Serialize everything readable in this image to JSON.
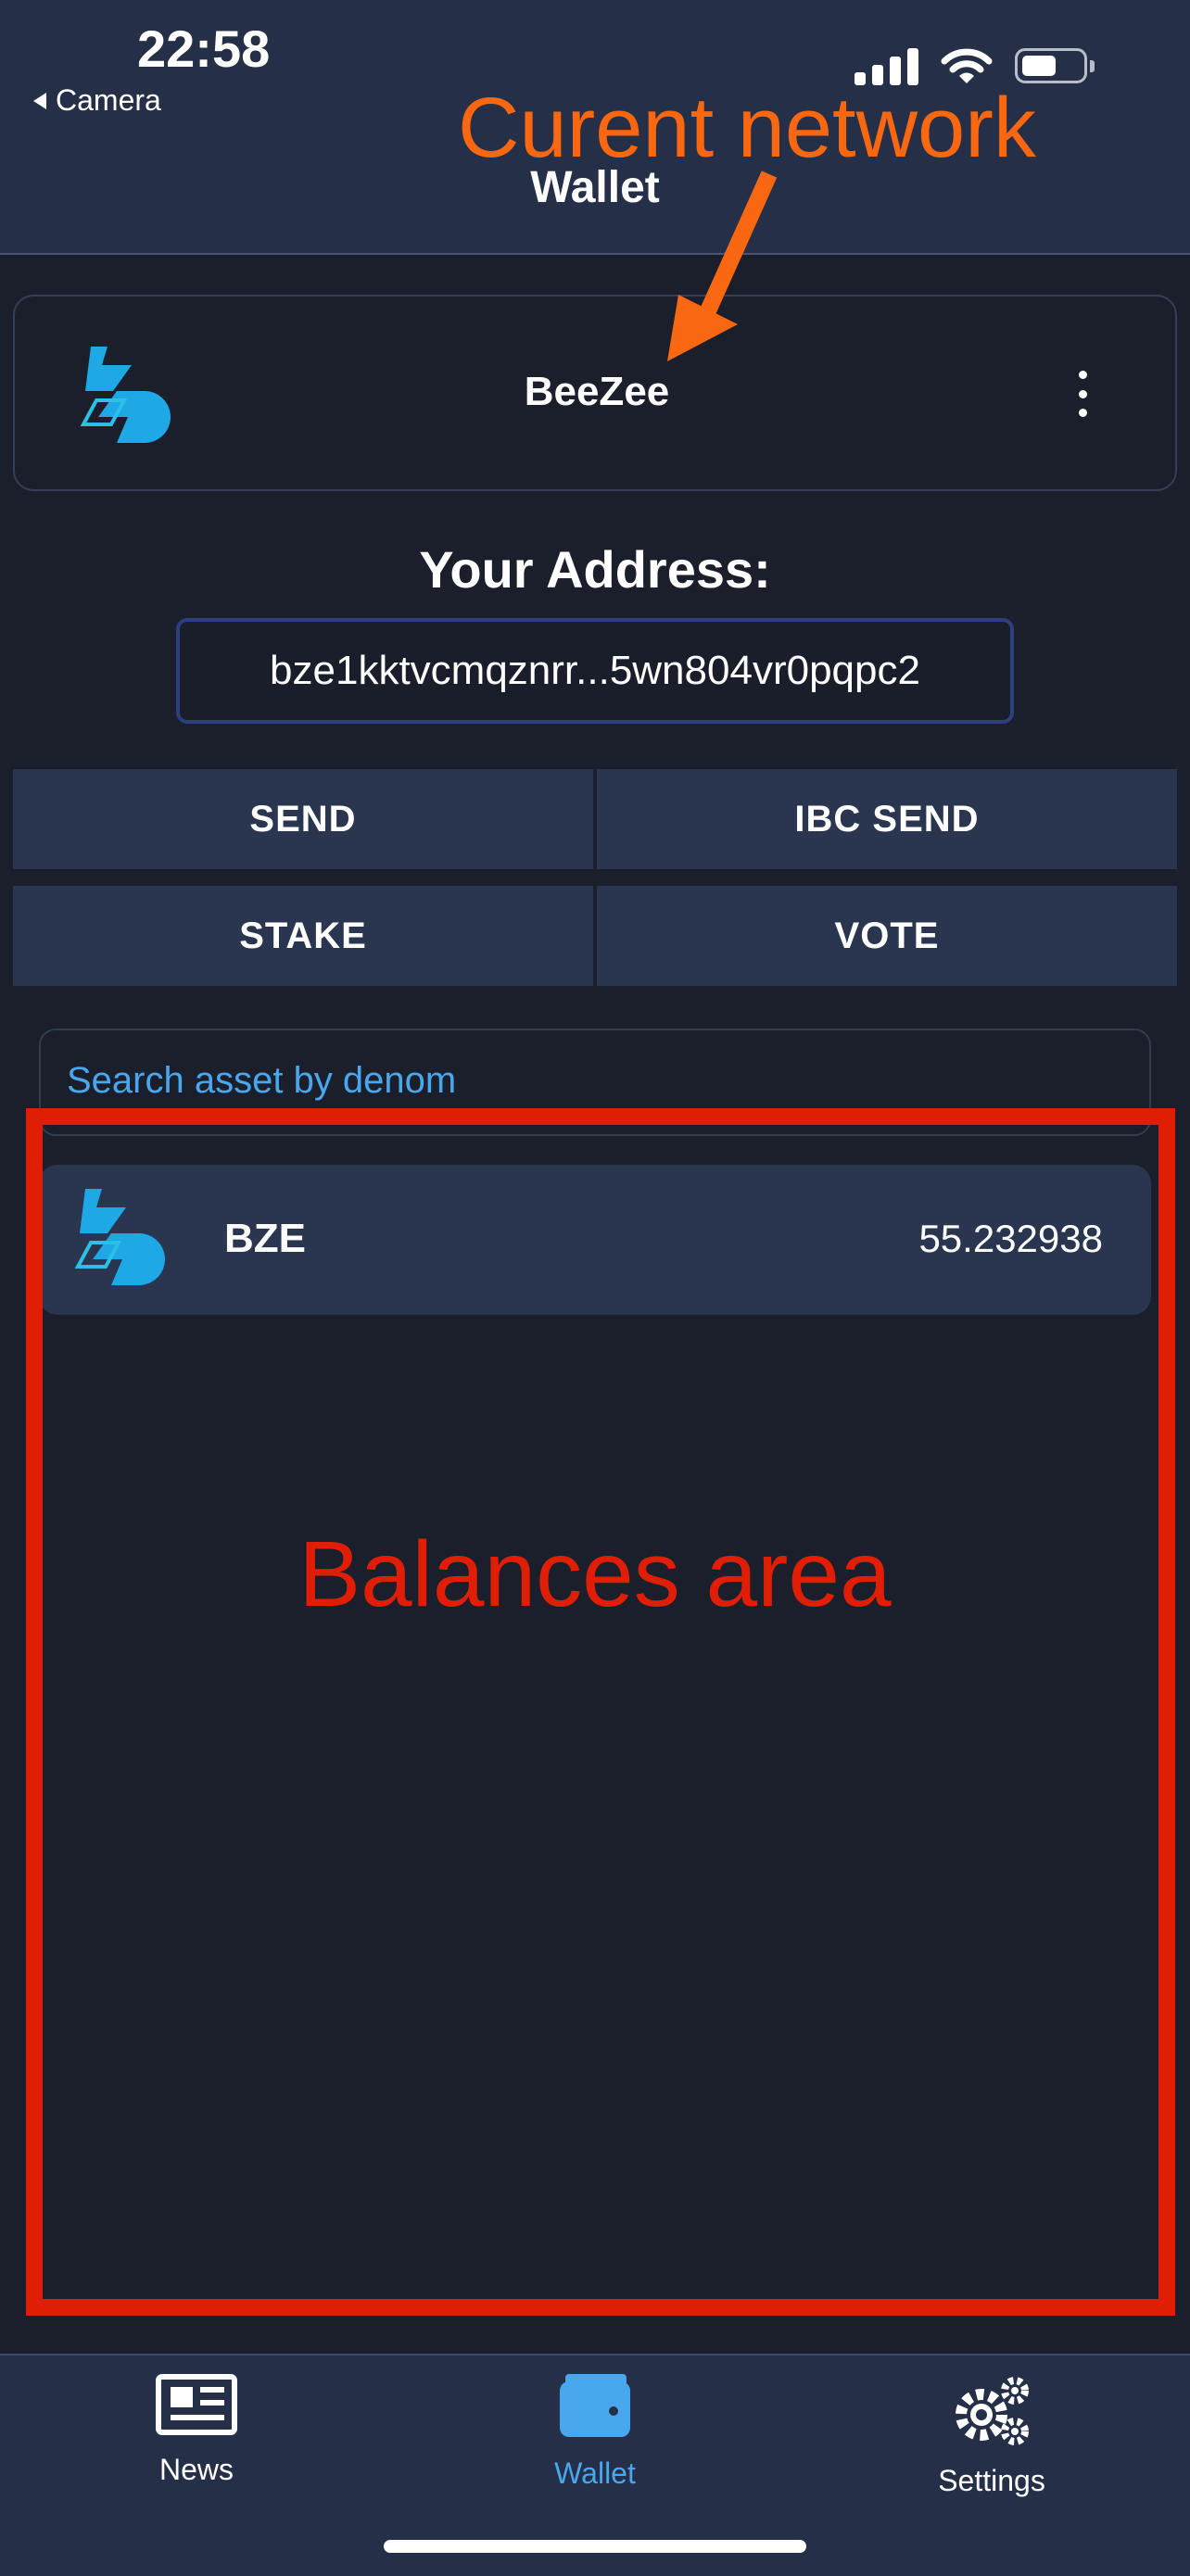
{
  "status_bar": {
    "time": "22:58",
    "back_label": "Camera"
  },
  "header": {
    "title": "Wallet"
  },
  "network": {
    "name": "BeeZee"
  },
  "address": {
    "label": "Your Address:",
    "value": "bze1kktvcmqznrr...5wn804vr0pqpc2"
  },
  "actions": {
    "send": "SEND",
    "ibc_send": "IBC SEND",
    "stake": "STAKE",
    "vote": "VOTE"
  },
  "search": {
    "placeholder": "Search asset by denom"
  },
  "assets": [
    {
      "denom": "BZE",
      "amount": "55.232938",
      "icon": "beezee-logo"
    }
  ],
  "annotations": {
    "current_network": "Curent network",
    "balances_area": "Balances area"
  },
  "tabs": [
    {
      "label": "News",
      "icon": "newspaper-icon"
    },
    {
      "label": "Wallet",
      "icon": "wallet-icon",
      "active": true
    },
    {
      "label": "Settings",
      "icon": "gears-icon"
    }
  ],
  "colors": {
    "background": "#1b1f2b",
    "header": "#252f48",
    "accent": "#49a7ee",
    "annotation_red": "#e01e05",
    "annotation_orange": "#fa6711"
  }
}
